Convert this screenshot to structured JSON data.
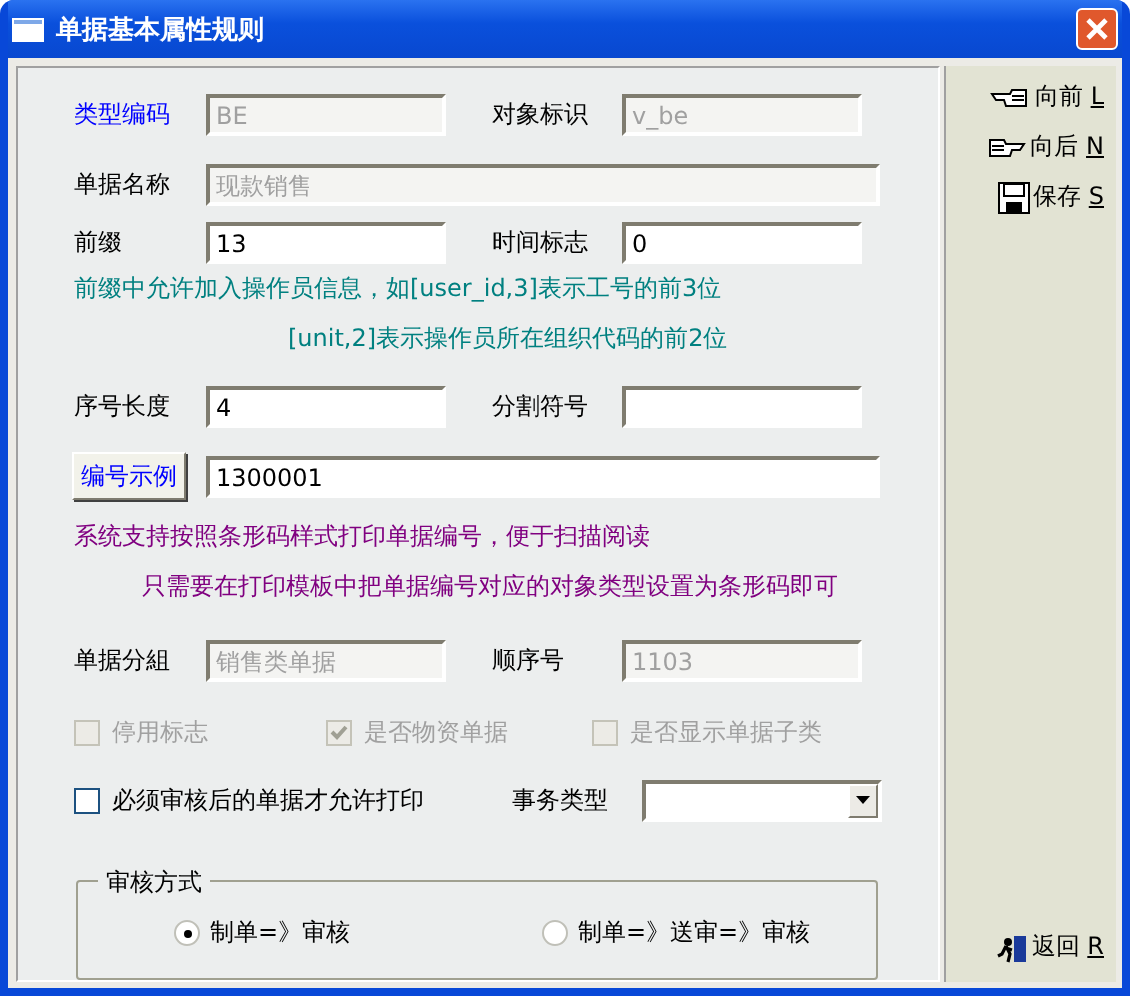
{
  "window": {
    "title": "单据基本属性规则"
  },
  "form": {
    "type_code": {
      "label": "类型编码",
      "link": true,
      "value": "BE",
      "disabled": true
    },
    "object_id": {
      "label": "对象标识",
      "value": "v_be",
      "disabled": true
    },
    "bill_name": {
      "label": "单据名称",
      "value": "现款销售",
      "disabled": true
    },
    "prefix": {
      "label": "前缀",
      "value": "13",
      "disabled": false
    },
    "time_flag": {
      "label": "时间标志",
      "value": "0",
      "disabled": false
    },
    "prefix_hints": [
      "前缀中允许加入操作员信息，如[user_id,3]表示工号的前3位",
      "[unit,2]表示操作员所在组织代码的前2位"
    ],
    "serial_length": {
      "label": "序号长度",
      "value": "4",
      "disabled": false
    },
    "separator": {
      "label": "分割符号",
      "disabled": false
    },
    "example_button": "编号示例",
    "example_value": "1300001",
    "barcode_hints": [
      "系统支持按照条形码样式打印单据编号，便于扫描阅读",
      "只需要在打印模板中把单据编号对应的对象类型设置为条形码即可"
    ],
    "bill_group": {
      "label": "单据分組",
      "value": "销售类单据",
      "disabled": true
    },
    "order_no": {
      "label": "顺序号",
      "value": "1103",
      "disabled": true
    },
    "checkboxes": [
      {
        "label": "停用标志",
        "checked": false,
        "disabled": true
      },
      {
        "label": "是否物资单据",
        "checked": true,
        "disabled": true
      },
      {
        "label": "是否显示单据子类",
        "checked": false,
        "disabled": true
      }
    ],
    "print_check": {
      "label": "必须审核后的单据才允许打印",
      "checked": false,
      "disabled": false
    },
    "transaction_type": {
      "label": "事务类型"
    },
    "audit_mode": {
      "title": "审核方式",
      "options": [
        {
          "label": "制单=》审核",
          "selected": true
        },
        {
          "label": "制单=》送审=》审核",
          "selected": false
        }
      ]
    }
  },
  "sidebar": {
    "buttons": [
      {
        "label": "向前",
        "key": "L"
      },
      {
        "label": "向后",
        "key": "N"
      },
      {
        "label": "保存",
        "key": "S"
      }
    ],
    "return_button": {
      "label": "返回",
      "key": "R"
    }
  }
}
